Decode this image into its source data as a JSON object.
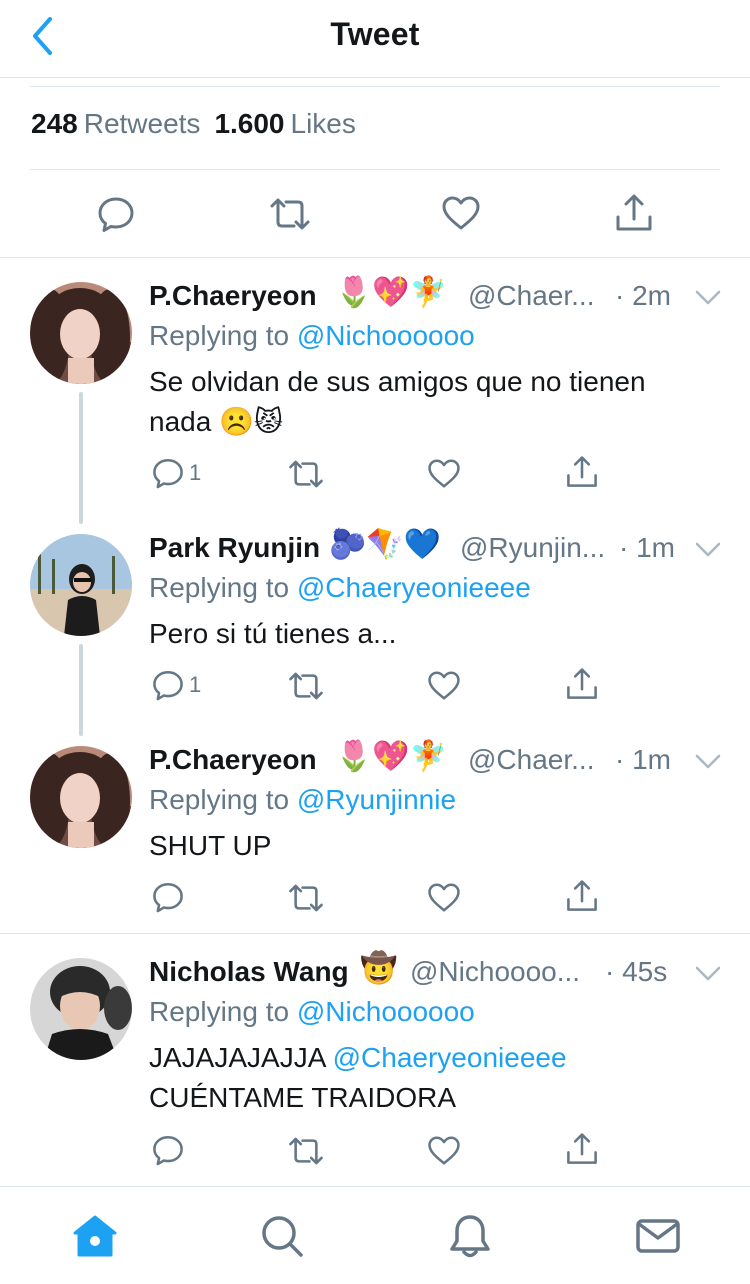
{
  "header": {
    "title": "Tweet"
  },
  "stats": {
    "retweets_count": "248",
    "retweets_label": "Retweets",
    "likes_count": "1.600",
    "likes_label": "Likes"
  },
  "colors": {
    "accent": "#1da1f2",
    "secondary_text": "#657786",
    "divider": "#e1e8ed",
    "thread_line": "#ccd6dd"
  },
  "icons": {
    "back": "chevron-left-icon",
    "reply": "reply-icon",
    "retweet": "retweet-icon",
    "like": "heart-icon",
    "share": "share-icon",
    "more": "chevron-down-icon",
    "home": "home-icon",
    "search": "search-icon",
    "notifications": "bell-icon",
    "messages": "envelope-icon"
  },
  "tweets": [
    {
      "name": "P.Chaeryeon",
      "name_emojis": "🌷💖🧚",
      "handle": "@Chaer...",
      "time": "· 2m",
      "replying_prefix": "Replying to",
      "replying_to": "@Nichoooooo",
      "text": "Se olvidan de sus amigos que no tienen nada ☹️😾",
      "reply_count": "1"
    },
    {
      "name": "Park Ryunjin",
      "name_emojis": "🫐🪁💙",
      "handle": "@Ryunjin...",
      "time": "· 1m",
      "replying_prefix": "Replying to",
      "replying_to": "@Chaeryeonieeee",
      "text": "Pero si tú tienes a...",
      "reply_count": "1"
    },
    {
      "name": "P.Chaeryeon",
      "name_emojis": "🌷💖🧚",
      "handle": "@Chaer...",
      "time": "· 1m",
      "replying_prefix": "Replying to",
      "replying_to": "@Ryunjinnie",
      "text": "SHUT UP",
      "reply_count": ""
    },
    {
      "name": "Nicholas Wang",
      "name_emojis": "🤠",
      "handle": "@Nichoooo...",
      "time": "· 45s",
      "replying_prefix": "Replying to",
      "replying_to": "@Nichoooooo",
      "text_line1_prefix": "JAJAJAJAJJA",
      "text_line1_mention": "@Chaeryeonieeee",
      "text_line2": "CUÉNTAME TRAIDORA",
      "reply_count": ""
    }
  ]
}
